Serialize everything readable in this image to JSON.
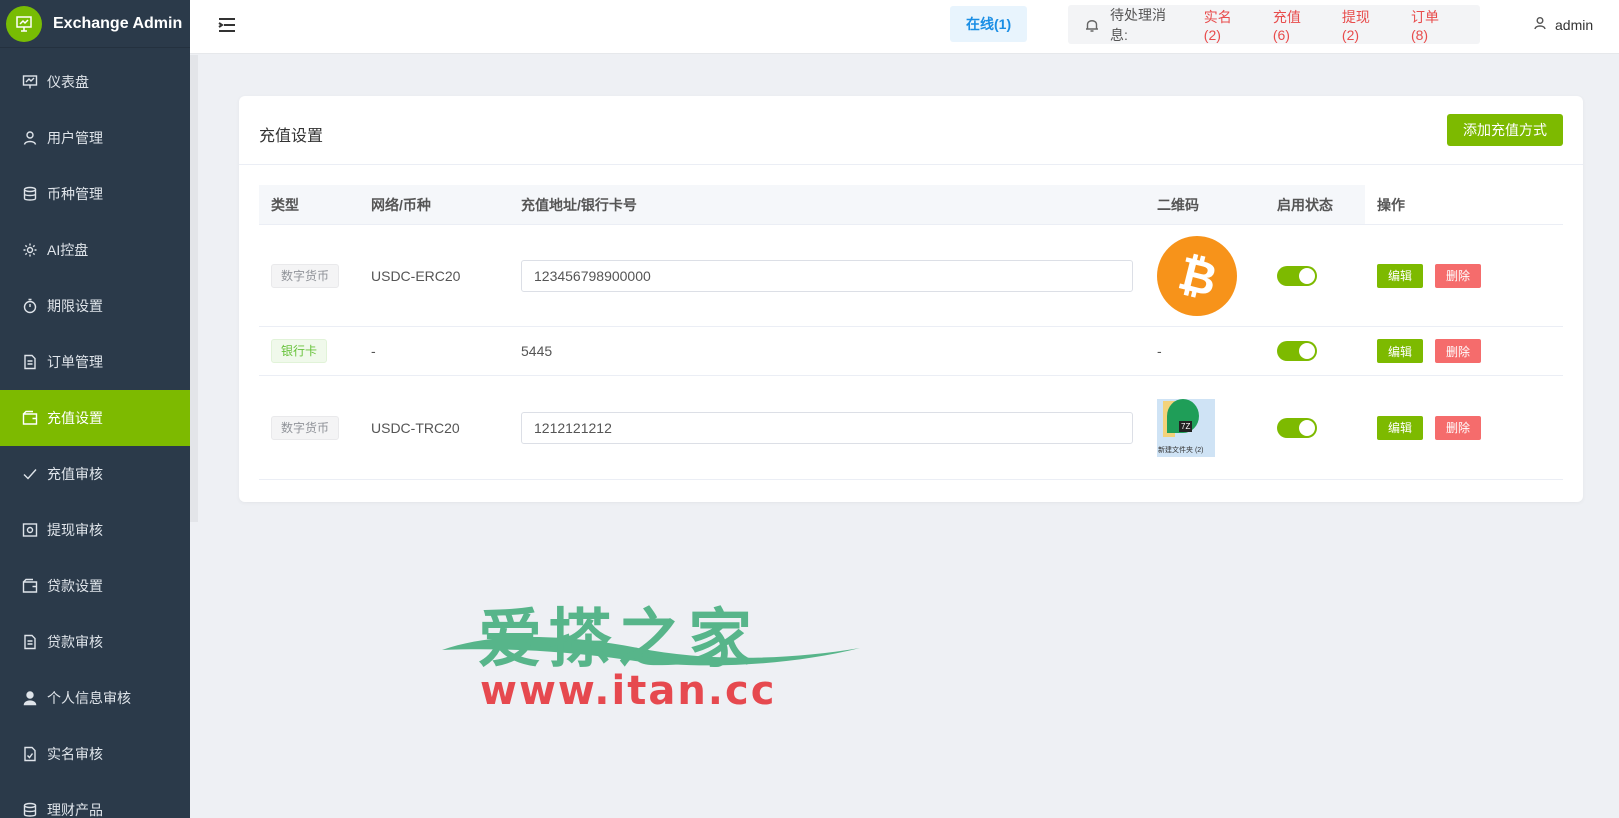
{
  "app": {
    "title": "Exchange Admin"
  },
  "sidebar": {
    "items": [
      {
        "label": "仪表盘",
        "icon": "dashboard-icon"
      },
      {
        "label": "用户管理",
        "icon": "user-icon"
      },
      {
        "label": "币种管理",
        "icon": "database-icon"
      },
      {
        "label": "AI控盘",
        "icon": "gear-icon"
      },
      {
        "label": "期限设置",
        "icon": "stopwatch-icon"
      },
      {
        "label": "订单管理",
        "icon": "document-icon"
      },
      {
        "label": "充值设置",
        "icon": "wallet-icon",
        "active": true
      },
      {
        "label": "充值审核",
        "icon": "check-icon"
      },
      {
        "label": "提现审核",
        "icon": "withdraw-icon"
      },
      {
        "label": "贷款设置",
        "icon": "wallet-icon"
      },
      {
        "label": "贷款审核",
        "icon": "document-icon"
      },
      {
        "label": "个人信息审核",
        "icon": "person-icon"
      },
      {
        "label": "实名审核",
        "icon": "document-check-icon"
      },
      {
        "label": "理财产品",
        "icon": "database-icon"
      }
    ]
  },
  "header": {
    "online": "在线(1)",
    "pending_label": "待处理消息:",
    "pending": [
      "实名(2)",
      "充值(6)",
      "提现(2)",
      "订单(8)"
    ],
    "user": "admin"
  },
  "card": {
    "title": "充值设置",
    "add_button": "添加充值方式"
  },
  "table": {
    "headers": [
      "类型",
      "网络/币种",
      "充值地址/银行卡号",
      "二维码",
      "启用状态",
      "操作"
    ],
    "rows": [
      {
        "type": "数字货币",
        "network": "USDC-ERC20",
        "address": "123456798900000",
        "qr": "bitcoin",
        "enabled": true,
        "edit": "编辑",
        "delete": "删除"
      },
      {
        "type": "银行卡",
        "network": "-",
        "address": "5445",
        "qr": "-",
        "enabled": true,
        "edit": "编辑",
        "delete": "删除"
      },
      {
        "type": "数字货币",
        "network": "USDC-TRC20",
        "address": "1212121212",
        "qr": "thumbnail",
        "qr_caption": "新建文件夹 (2)",
        "qr_badge": "7Z",
        "enabled": true,
        "edit": "编辑",
        "delete": "删除"
      }
    ]
  },
  "watermark": {
    "title": "爱搽之家",
    "url": "www.itan.cc"
  },
  "colors": {
    "accent": "#7dba00",
    "sidebar": "#2b3a4a",
    "danger": "#f56c6c",
    "link_red": "#e84c4c",
    "online_blue": "#1a8ee5"
  }
}
